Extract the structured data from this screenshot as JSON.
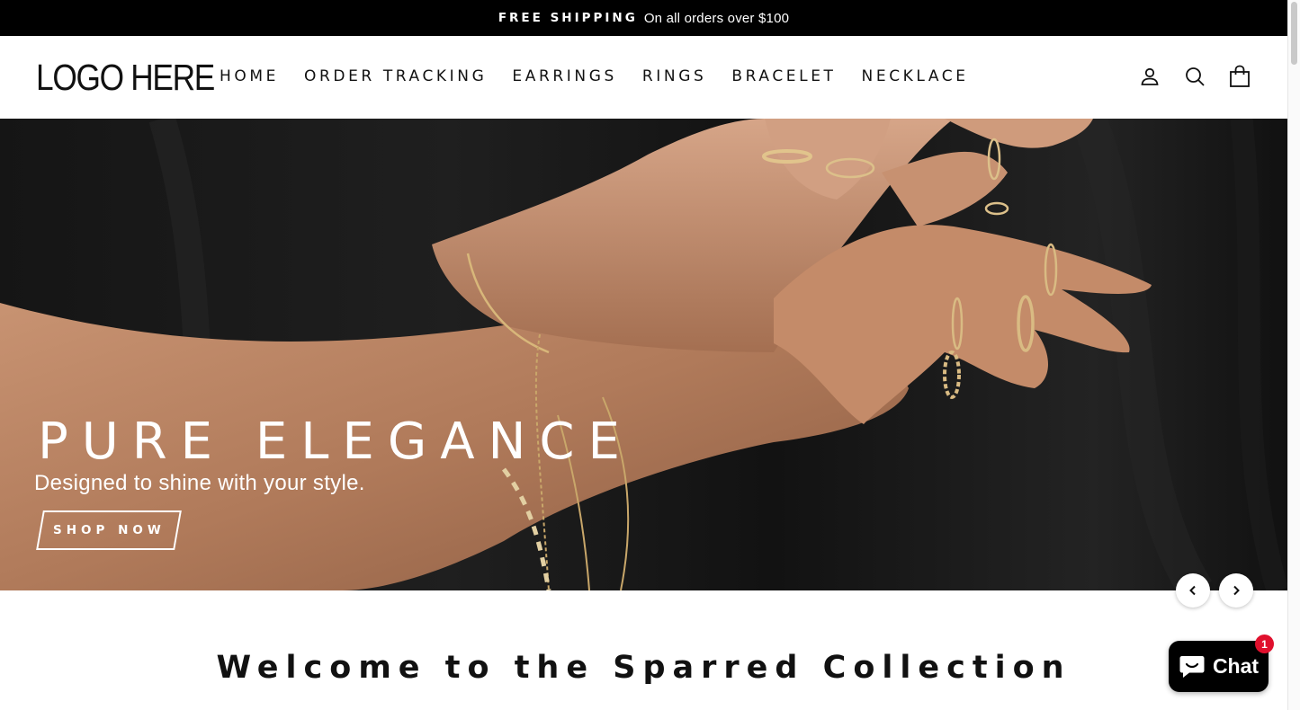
{
  "announcement": {
    "highlight": "FREE SHIPPING",
    "text": "On all orders over $100"
  },
  "header": {
    "logo": "LOGO HERE",
    "nav": [
      {
        "label": "HOME"
      },
      {
        "label": "ORDER TRACKING"
      },
      {
        "label": "EARRINGS"
      },
      {
        "label": "RINGS"
      },
      {
        "label": "BRACELET"
      },
      {
        "label": "NECKLACE"
      }
    ],
    "icons": [
      "account-icon",
      "search-icon",
      "cart-icon"
    ]
  },
  "hero": {
    "title": "PURE ELEGANCE",
    "subtitle": "Designed to shine with your style.",
    "cta_label": "SHOP NOW",
    "prev_icon": "chevron-left-icon",
    "next_icon": "chevron-right-icon"
  },
  "welcome": {
    "heading": "Welcome to the Sparred Collection"
  },
  "chat": {
    "label": "Chat",
    "badge_count": "1",
    "badge_color": "#e0102d"
  },
  "colors": {
    "announcement_bg": "#000000",
    "hero_bg": "#141414",
    "text": "#111111"
  }
}
